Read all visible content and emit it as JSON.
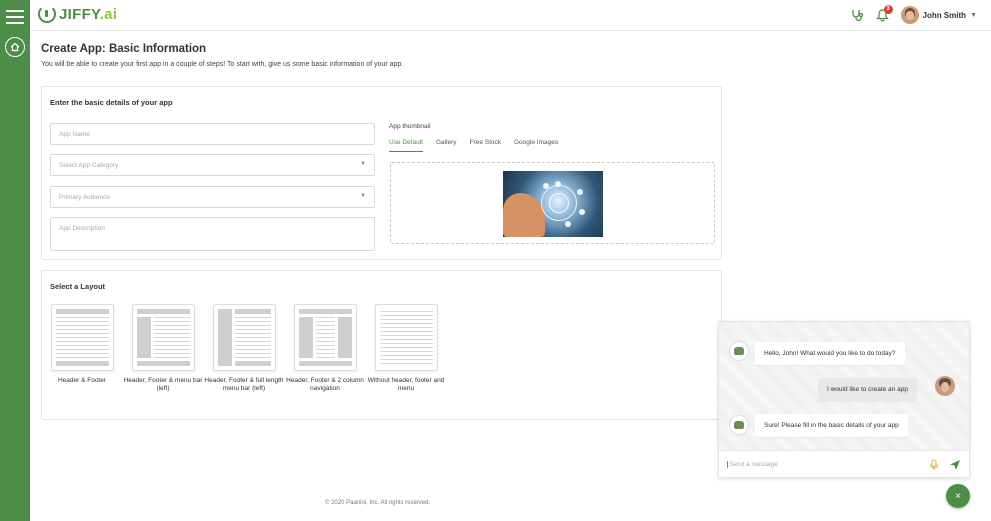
{
  "brand": {
    "name": "JIFFY",
    "suffix": ".ai"
  },
  "header": {
    "notification_count": "3",
    "user_name": "John Smith",
    "icons": [
      "stethoscope-icon",
      "bell-icon",
      "avatar",
      "chevron-down-icon"
    ]
  },
  "page": {
    "title": "Create App: Basic Information",
    "subtitle": "You will be able to create your first app in a couple of steps! To start with, give us some basic information of your app."
  },
  "details": {
    "heading": "Enter the basic details of your app",
    "app_name_placeholder": "App Name",
    "category_placeholder": "Select App Category",
    "audience_placeholder": "Primary Audience",
    "description_placeholder": "App Description",
    "thumbnail_label": "App thumbnail",
    "tabs": [
      "Use Default",
      "Gallery",
      "Free Stock",
      "Google Images"
    ],
    "active_tab": "Use Default"
  },
  "layout_section": {
    "heading": "Select a Layout",
    "options": [
      {
        "label": "Header & Footer"
      },
      {
        "label": "Header, Footer & menu bar (left)"
      },
      {
        "label": "Header, Footer & full length menu bar (left)"
      },
      {
        "label": "Header, Footer & 2 column navigation"
      },
      {
        "label": "Without header, footer and menu"
      }
    ]
  },
  "footer": {
    "copyright": "© 2020 Paanini, Inc. All rights reserved."
  },
  "chat": {
    "messages": [
      {
        "from": "bot",
        "text": "Hello, John! What would you like to do today?"
      },
      {
        "from": "user",
        "text": "I would like to create an app"
      },
      {
        "from": "bot",
        "text": "Sure! Please fill in the basic details of your app"
      }
    ],
    "input_placeholder": "Send a message",
    "close_label": "×"
  },
  "colors": {
    "brand_green": "#4c8e47",
    "accent_lime": "#8cc63f",
    "badge_red": "#e23b3b"
  }
}
